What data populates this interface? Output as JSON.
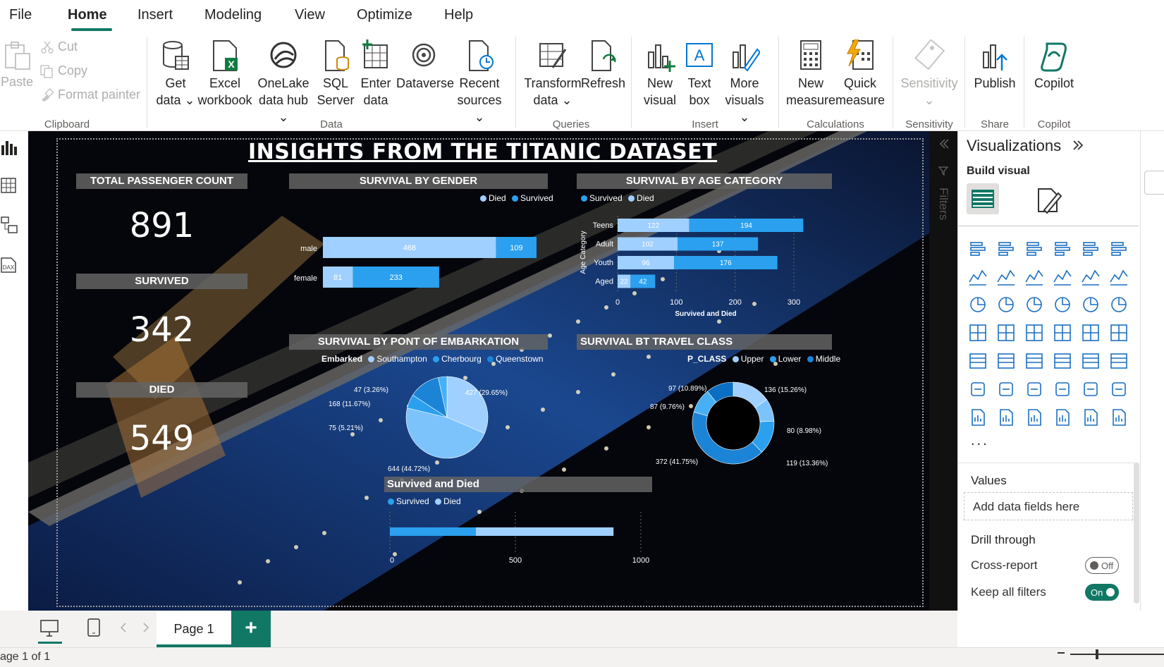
{
  "menu": {
    "tabs": [
      "File",
      "Home",
      "Insert",
      "Modeling",
      "View",
      "Optimize",
      "Help"
    ],
    "active": "Home"
  },
  "ribbon": {
    "clipboard": {
      "paste": "Paste",
      "cut": "Cut",
      "copy": "Copy",
      "format_painter": "Format painter",
      "group": "Clipboard"
    },
    "data": {
      "get_data": [
        "Get",
        "data ⌄"
      ],
      "excel": [
        "Excel",
        "workbook"
      ],
      "onelake": [
        "OneLake",
        "data hub ⌄"
      ],
      "sql": [
        "SQL",
        "Server"
      ],
      "enter": [
        "Enter",
        "data"
      ],
      "dataverse": [
        "Dataverse",
        ""
      ],
      "recent": [
        "Recent",
        "sources ⌄"
      ],
      "group": "Data"
    },
    "queries": {
      "transform": [
        "Transform",
        "data ⌄"
      ],
      "refresh": [
        "Refresh",
        ""
      ],
      "group": "Queries"
    },
    "insert": {
      "new_visual": [
        "New",
        "visual"
      ],
      "text_box": [
        "Text",
        "box"
      ],
      "more_visuals": [
        "More",
        "visuals ⌄"
      ],
      "group": "Insert"
    },
    "calculations": {
      "new_measure": [
        "New",
        "measure"
      ],
      "quick_measure": [
        "Quick",
        "measure"
      ],
      "group": "Calculations"
    },
    "sensitivity": {
      "label": [
        "Sensitivity",
        "⌄"
      ],
      "group": "Sensitivity"
    },
    "share": {
      "publish": [
        "Publish",
        ""
      ],
      "group": "Share"
    },
    "copilot": {
      "copilot": [
        "Copilot",
        ""
      ],
      "group": "Copilot"
    }
  },
  "report": {
    "title": "INSIGHTS FROM THE TITANIC DATASET",
    "kpis": [
      {
        "label": "TOTAL PASSENGER COUNT",
        "value": "891"
      },
      {
        "label": "SURVIVED",
        "value": "342"
      },
      {
        "label": "DIED",
        "value": "549"
      }
    ],
    "gender": {
      "title": "SURVIVAL BY GENDER",
      "legend": [
        "Died",
        "Survived"
      ]
    },
    "age": {
      "title": "SURVIVAL BY AGE CATEGORY",
      "legend": [
        "Survived",
        "Died"
      ]
    },
    "embark": {
      "title": "SURVIVAL BY PONT OF EMBARKATION",
      "legend_title": "Embarked",
      "legend": [
        "Southampton",
        "Cherbourg",
        "Queenstown"
      ]
    },
    "pclass": {
      "title": "SURVIVAL BT TRAVEL CLASS",
      "legend_title": "P_CLASS",
      "legend": [
        "Upper",
        "Lower",
        "Middle"
      ]
    },
    "survived_died": {
      "title": "Survived and Died",
      "legend": [
        "Survived",
        "Died"
      ]
    }
  },
  "chart_data": [
    {
      "type": "bar",
      "title": "SURVIVAL BY GENDER",
      "categories": [
        "male",
        "female"
      ],
      "series": [
        {
          "name": "Died",
          "values": [
            468,
            81
          ]
        },
        {
          "name": "Survived",
          "values": [
            109,
            233
          ]
        }
      ]
    },
    {
      "type": "bar",
      "title": "SURVIVAL BY AGE CATEGORY",
      "categories": [
        "Teens",
        "Adult",
        "Youth",
        "Aged"
      ],
      "series": [
        {
          "name": "Survived",
          "values": [
            122,
            102,
            96,
            22
          ]
        },
        {
          "name": "Died",
          "values": [
            194,
            137,
            176,
            42
          ]
        }
      ],
      "xlabel": "Survived and Died",
      "ylabel": "Age Category",
      "xticks": [
        "0",
        "100",
        "200",
        "300"
      ],
      "xlim": [
        0,
        300
      ]
    },
    {
      "type": "pie",
      "title": "SURVIVAL BY PONT OF EMBARKATION",
      "labels": [
        "427 (29.65%)",
        "644 (44.72%)",
        "75 (5.21%)",
        "168 (11.67%)",
        "47 (3.26%)"
      ],
      "values": [
        427,
        644,
        75,
        168,
        47
      ]
    },
    {
      "type": "pie",
      "title": "SURVIVAL BT TRAVEL CLASS",
      "labels": [
        "136 (15.26%)",
        "80 (8.98%)",
        "119 (13.36%)",
        "372 (41.75%)",
        "87 (9.76%)",
        "97 (10.89%)"
      ],
      "values": [
        136,
        80,
        119,
        372,
        87,
        97
      ]
    },
    {
      "type": "bar",
      "title": "Survived and Died",
      "categories": [
        ""
      ],
      "series": [
        {
          "name": "Survived",
          "values": [
            342
          ]
        },
        {
          "name": "Died",
          "values": [
            549
          ]
        }
      ],
      "xticks": [
        "0",
        "500",
        "1000"
      ],
      "xlim": [
        0,
        1000
      ]
    }
  ],
  "visualizations": {
    "title": "Visualizations",
    "build_visual": "Build visual",
    "more": "...",
    "values_label": "Values",
    "values_placeholder": "Add data fields here",
    "drill_through": "Drill through",
    "cross_report": "Cross-report",
    "cross_report_state": "Off",
    "keep_filters": "Keep all filters",
    "keep_filters_state": "On"
  },
  "filters_label": "Filters",
  "pages": {
    "page1": "Page 1",
    "add": "+"
  },
  "status": {
    "page": "age 1 of 1"
  }
}
